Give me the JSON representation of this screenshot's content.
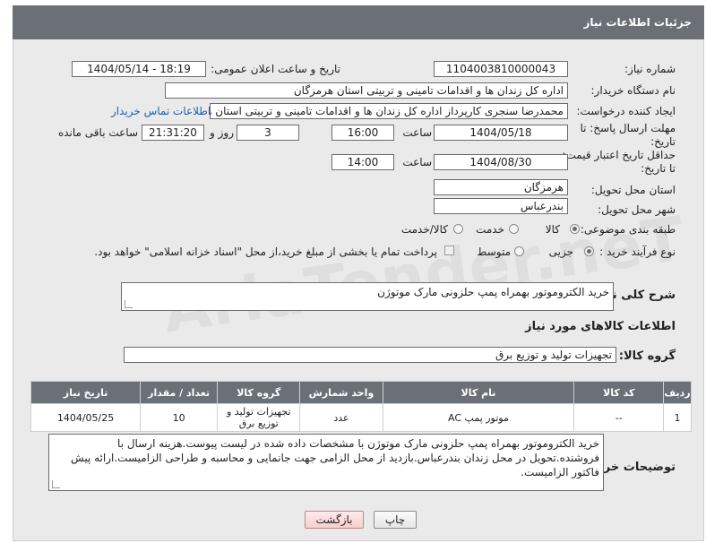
{
  "header": {
    "title": "جزئیات اطلاعات نیاز"
  },
  "form": {
    "need_number": {
      "label": "شماره نیاز:",
      "value": "1104003810000043"
    },
    "announce_datetime": {
      "label": "تاریخ و ساعت اعلان عمومی:",
      "value": "1404/05/14 - 18:19"
    },
    "buyer_org": {
      "label": "نام دستگاه خریدار:",
      "value": "اداره کل زندان ها و اقدامات تامینی و تربیتی استان هرمزگان"
    },
    "requester": {
      "label": "ایجاد کننده درخواست:",
      "value": "محمدرضا سنجری کارپرداز اداره کل زندان ها و اقدامات تامینی و تربیتی استان هرمزگان",
      "contact_link": "اطلاعات تماس خریدار"
    },
    "reply_deadline": {
      "label_line1": "مهلت ارسال پاسخ: تا",
      "label_line2": "تاریخ:",
      "date": "1404/05/18",
      "time_label": "ساعت",
      "time": "16:00",
      "days": "3",
      "days_label": "روز و",
      "remaining_time": "21:31:20",
      "remaining_label": "ساعت باقی مانده"
    },
    "price_validity": {
      "label_line1": "حداقل تاریخ اعتبار قیمت:",
      "label_line2": "تا تاریخ:",
      "date": "1404/08/30",
      "time_label": "ساعت",
      "time": "14:00"
    },
    "delivery_province": {
      "label": "استان محل تحویل:",
      "value": "هرمزگان"
    },
    "delivery_city": {
      "label": "شهر محل تحویل:",
      "value": "بندرعباس"
    },
    "category": {
      "label": "طبقه بندی موضوعی:",
      "options": [
        "کالا",
        "خدمت",
        "کالا/خدمت"
      ],
      "selected": "کالا"
    },
    "purchase_process": {
      "label": "نوع فرآیند خرید :",
      "options": [
        "جزیی",
        "متوسط"
      ],
      "selected": "جزیی",
      "payment_note": "پرداخت تمام یا بخشی از مبلغ خرید،از محل \"اسناد خزانه اسلامی\" خواهد بود."
    }
  },
  "summary": {
    "label": "شرح کلی نیاز:",
    "value": "خرید الکتروموتور بهمراه پمپ حلزونی مارک موتوژن"
  },
  "goods_section": {
    "title": "اطلاعات کالاهای مورد نیاز",
    "group_label": "گروه کالا:",
    "group_value": "تجهیزات تولید و توزیع برق"
  },
  "items_table": {
    "headers": [
      "ردیف",
      "کد کالا",
      "نام کالا",
      "واحد شمارش",
      "گروه کالا",
      "تعداد / مقدار",
      "تاریخ نیاز"
    ],
    "rows": [
      {
        "row": "1",
        "code": "--",
        "name": "موتور پمپ AC",
        "unit": "عدد",
        "group": "تجهیزات تولید و توزیع برق",
        "qty": "10",
        "date": "1404/05/25"
      }
    ]
  },
  "buyer_notes": {
    "label": "توضیحات خریدار:",
    "value": "خرید الکتروموتور بهمراه پمپ حلزونی مارک موتوژن با مشخصات داده شده در لیست پیوست.هزینه ارسال با فروشنده.تحویل در محل زندان بندرعباس.بازدید از محل الزامی جهت جانمایی و محاسبه و طراحی الزامیست.ارائه پیش فاکتور الزامیست."
  },
  "buttons": {
    "print": "چاپ",
    "back": "بازگشت"
  },
  "watermark": "AriaTender.neT"
}
